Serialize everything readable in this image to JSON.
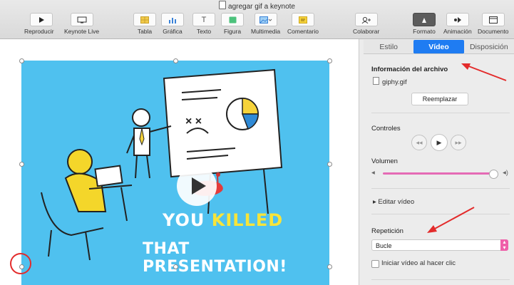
{
  "window": {
    "title": "agregar gif a keynote"
  },
  "toolbar": {
    "play": "Reproducir",
    "keynote_live": "Keynote Live",
    "table": "Tabla",
    "chart": "Gráfica",
    "text": "Texto",
    "shape": "Figura",
    "media": "Multimedia",
    "comment": "Comentario",
    "collaborate": "Colaborar",
    "format": "Formato",
    "animate": "Animación",
    "document": "Documento"
  },
  "slide": {
    "text_you": "YOU",
    "text_killed": "KILLED",
    "text_line2": "THAT PRESENTATION!"
  },
  "inspector": {
    "tabs": [
      "Estilo",
      "Vídeo",
      "Disposición"
    ],
    "file_info_title": "Información del archivo",
    "file_name": "giphy.gif",
    "replace_button": "Reemplazar",
    "controls_title": "Controles",
    "volume_title": "Volumen",
    "volume_level": 0.95,
    "edit_video": "Editar vídeo",
    "repeat_title": "Repetición",
    "repeat_value": "Bucle",
    "start_on_click": "Iniciar vídeo al hacer clic"
  },
  "colors": {
    "accent": "#1f7cf2",
    "slide_bg": "#4fc1ef",
    "highlight_yellow": "#f7e43a",
    "annotation_red": "#e32b2b",
    "slider_pink": "#e56bb5"
  }
}
